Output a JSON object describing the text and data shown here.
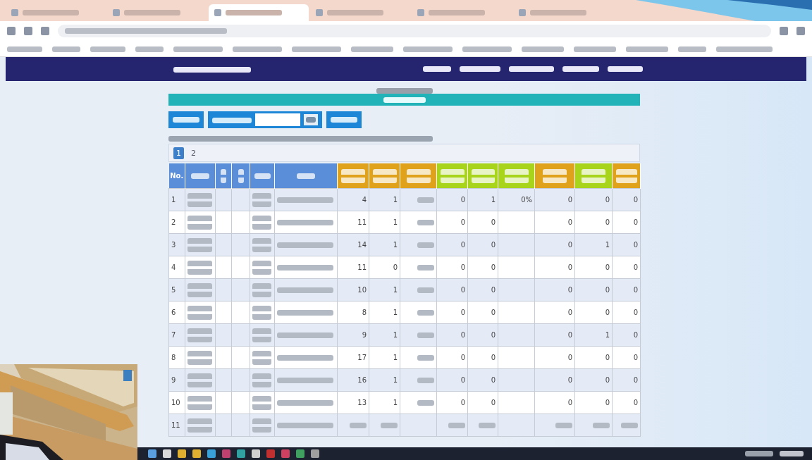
{
  "browser": {
    "tabs": [
      {
        "selected": false
      },
      {
        "selected": false
      },
      {
        "selected": true
      },
      {
        "selected": false
      },
      {
        "selected": false
      },
      {
        "selected": false
      }
    ]
  },
  "pagination": [
    {
      "label": "1",
      "selected": true
    },
    {
      "label": "2",
      "selected": false
    }
  ],
  "table": {
    "columns": [
      {
        "kind": "number",
        "label": "No.",
        "color": "#5b8ed8"
      },
      {
        "kind": "blurred",
        "color": "#5b8ed8"
      },
      {
        "kind": "empty",
        "color": "#5b8ed8"
      },
      {
        "kind": "empty",
        "color": "#5b8ed8"
      },
      {
        "kind": "blurred",
        "color": "#5b8ed8"
      },
      {
        "kind": "blurred",
        "color": "#5b8ed8"
      },
      {
        "kind": "value",
        "color": "#e0a21a"
      },
      {
        "kind": "value",
        "color": "#e0a21a"
      },
      {
        "kind": "value",
        "color": "#e0a21a"
      },
      {
        "kind": "value",
        "color": "#a8d41c"
      },
      {
        "kind": "value",
        "color": "#a8d41c"
      },
      {
        "kind": "value",
        "color": "#a8d41c"
      },
      {
        "kind": "value",
        "color": "#e0a21a"
      },
      {
        "kind": "value",
        "color": "#a8d41c"
      },
      {
        "kind": "value",
        "color": "#e0a21a"
      }
    ],
    "rows": [
      {
        "no": "1",
        "values": [
          "4",
          "1",
          {
            "kind": "blurred"
          },
          "0",
          "1",
          "0%",
          "0",
          "0",
          "0"
        ]
      },
      {
        "no": "2",
        "values": [
          "11",
          "1",
          {
            "kind": "blurred"
          },
          "0",
          "0",
          {
            "kind": "empty"
          },
          "0",
          "0",
          "0"
        ]
      },
      {
        "no": "3",
        "values": [
          "14",
          "1",
          {
            "kind": "blurred"
          },
          "0",
          "0",
          {
            "kind": "empty"
          },
          "0",
          "1",
          "0"
        ]
      },
      {
        "no": "4",
        "values": [
          "11",
          "0",
          {
            "kind": "blurred"
          },
          "0",
          "0",
          {
            "kind": "empty"
          },
          "0",
          "0",
          "0"
        ]
      },
      {
        "no": "5",
        "values": [
          "10",
          "1",
          {
            "kind": "blurred"
          },
          "0",
          "0",
          {
            "kind": "empty"
          },
          "0",
          "0",
          "0"
        ]
      },
      {
        "no": "6",
        "values": [
          "8",
          "1",
          {
            "kind": "blurred"
          },
          "0",
          "0",
          {
            "kind": "empty"
          },
          "0",
          "0",
          "0"
        ]
      },
      {
        "no": "7",
        "values": [
          "9",
          "1",
          {
            "kind": "blurred"
          },
          "0",
          "0",
          {
            "kind": "empty"
          },
          "0",
          "1",
          "0"
        ]
      },
      {
        "no": "8",
        "values": [
          "17",
          "1",
          {
            "kind": "blurred"
          },
          "0",
          "0",
          {
            "kind": "empty"
          },
          "0",
          "0",
          "0"
        ]
      },
      {
        "no": "9",
        "values": [
          "16",
          "1",
          {
            "kind": "blurred"
          },
          "0",
          "0",
          {
            "kind": "empty"
          },
          "0",
          "0",
          "0"
        ]
      },
      {
        "no": "10",
        "values": [
          "13",
          "1",
          {
            "kind": "blurred"
          },
          "0",
          "0",
          {
            "kind": "empty"
          },
          "0",
          "0",
          "0"
        ]
      },
      {
        "no": "11",
        "values": [
          {
            "kind": "blurred"
          },
          {
            "kind": "blurred"
          },
          {
            "kind": "empty"
          },
          {
            "kind": "blurred"
          },
          {
            "kind": "blurred"
          },
          {
            "kind": "empty"
          },
          {
            "kind": "blurred"
          },
          {
            "kind": "blurred"
          },
          {
            "kind": "blurred"
          }
        ]
      }
    ]
  }
}
